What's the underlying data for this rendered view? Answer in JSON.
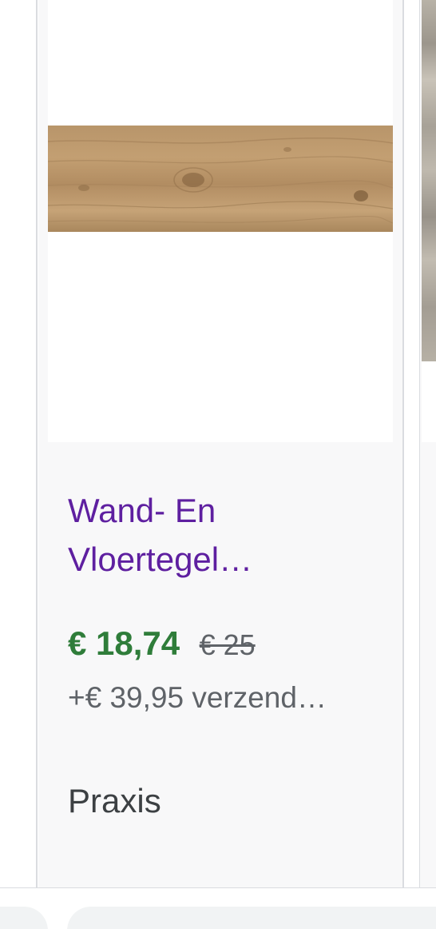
{
  "product": {
    "title": "Wand- En Vloertegel…",
    "price": "€ 18,74",
    "old_price": "€ 25",
    "shipping": "+€ 39,95 verzend…",
    "store": "Praxis",
    "title_color": "#5e1fa0",
    "price_color": "#2f7d3a",
    "image": "wood-plank-tile-image"
  },
  "next_product": {
    "image": "stone-tile-image"
  }
}
